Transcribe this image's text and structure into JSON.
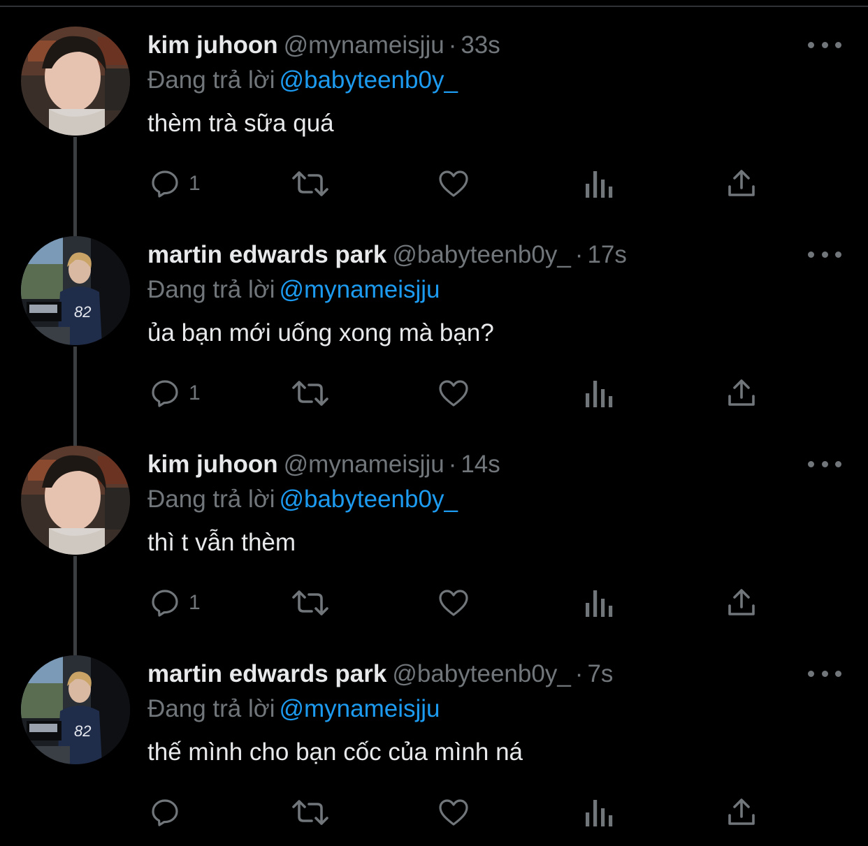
{
  "theme": {
    "background": "#000000",
    "text_primary": "#e7e9ea",
    "text_secondary": "#71767b",
    "accent": "#1d9bf0",
    "thread_line": "#3a3e41"
  },
  "icons": {
    "reply": "reply-icon",
    "retweet": "retweet-icon",
    "like": "like-icon",
    "views": "views-icon",
    "share": "share-icon",
    "more": "more-icon"
  },
  "tweets": [
    {
      "name": "kim juhoon",
      "handle": "@mynameisjju",
      "dot": "·",
      "time": "33s",
      "replying_label": "Đang trả lời",
      "replying_to": "@babyteenb0y_",
      "text": "thèm trà sữa quá",
      "reply_count": "1"
    },
    {
      "name": "martin edwards park",
      "handle": "@babyteenb0y_",
      "dot": "·",
      "time": "17s",
      "replying_label": "Đang trả lời",
      "replying_to": "@mynameisjju",
      "text": "ủa bạn mới uống xong mà bạn?",
      "reply_count": "1"
    },
    {
      "name": "kim juhoon",
      "handle": "@mynameisjju",
      "dot": "·",
      "time": "14s",
      "replying_label": "Đang trả lời",
      "replying_to": "@babyteenb0y_",
      "text": "thì t vẫn thèm",
      "reply_count": "1"
    },
    {
      "name": "martin edwards park",
      "handle": "@babyteenb0y_",
      "dot": "·",
      "time": "7s",
      "replying_label": "Đang trả lời",
      "replying_to": "@mynameisjju",
      "text": "thế mình cho bạn cốc của mình ná",
      "reply_count": ""
    }
  ]
}
